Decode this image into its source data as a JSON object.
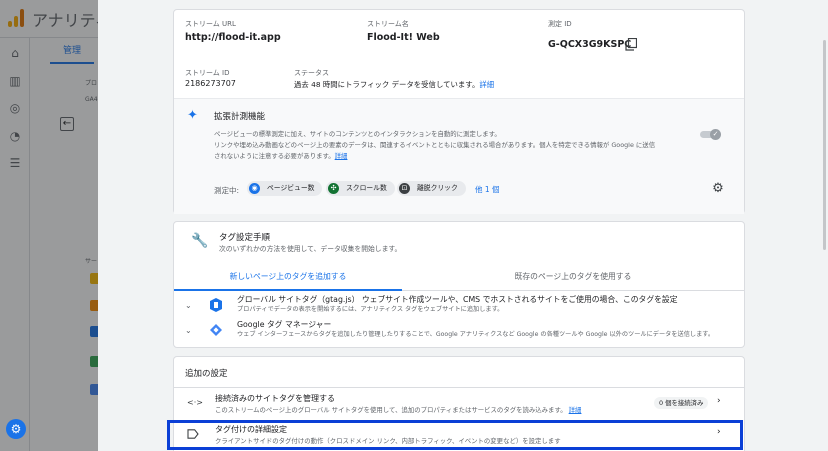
{
  "app": {
    "title": "アナリティ",
    "admin_tab": "管理",
    "side_label_1": "プロ",
    "side_label_2": "GA4",
    "side_label_3": "サー"
  },
  "stream": {
    "url_label": "ストリーム URL",
    "url_value": "http://flood-it.app",
    "name_label": "ストリーム名",
    "name_value": "Flood-It! Web",
    "id_label": "測定 ID",
    "id_value": "G-QCX3G9KSPC",
    "stream_id_label": "ストリーム ID",
    "stream_id_value": "2186273707",
    "status_label": "ステータス",
    "status_value": "過去 48 時間にトラフィック データを受信しています。",
    "status_link": "詳細"
  },
  "enhanced": {
    "title": "拡張計測機能",
    "desc_1": "ページビューの標準測定に加え、サイトのコンテンツとのインタラクションを自動的に測定します。",
    "desc_2": "リンクや埋め込み動画などのページ上の要素のデータは、関連するイベントとともに収集される場合があります。個人を特定できる情報が Google に送信",
    "desc_3": "されないように注意する必要があります。",
    "desc_link": "詳細",
    "enabled": true,
    "measuring_label": "測定中:",
    "chips": [
      {
        "label": "ページビュー数",
        "icon": "eye-icon",
        "color": "#1a73e8"
      },
      {
        "label": "スクロール数",
        "icon": "scroll-icon",
        "color": "#137333"
      },
      {
        "label": "離脱クリック",
        "icon": "lock-icon",
        "color": "#3c4043"
      }
    ],
    "more_link": "他 1 個"
  },
  "tag_setup": {
    "title": "タグ設定手順",
    "subtitle": "次のいずれかの方法を使用して、データ収集を開始します。",
    "tabs": [
      "新しいページ上のタグを追加する",
      "既存のページ上のタグを使用する"
    ],
    "rows": [
      {
        "title": "グローバル サイトタグ（gtag.js） ウェブサイト作成ツールや、CMS でホストされるサイトをご使用の場合、このタグを設定",
        "desc": "プロパティでデータの表示を開始するには、アナリティクス タグをウェブサイトに追加します。"
      },
      {
        "title": "Google タグ マネージャー",
        "desc": "ウェブ インターフェースからタグを追加したり管理したりすることで、Google アナリティクスなど Google の各種ツールや Google 以外のツールにデータを送信します。"
      }
    ]
  },
  "additional": {
    "heading": "追加の設定",
    "rows": [
      {
        "title": "接続済みのサイトタグを管理する",
        "desc": "このストリームのページ上のグローバル サイトタグを使用して、追加のプロパティまたはサービスのタグを読み込みます。",
        "link": "詳細",
        "badge": "0 個を接続済み"
      },
      {
        "title": "タグ付けの詳細設定",
        "desc": "クライアントサイドのタグ付けの動作（クロスドメイン リンク、内部トラフィック、イベントの変更など）を設定します"
      }
    ]
  },
  "colors": {
    "accent": "#1a73e8",
    "highlight": "#0b3fd6"
  }
}
